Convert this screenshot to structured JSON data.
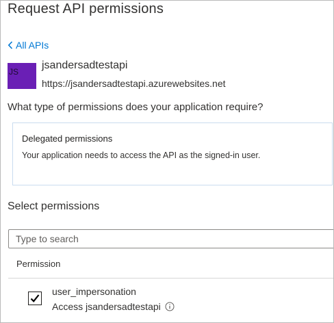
{
  "page": {
    "title": "Request API permissions"
  },
  "nav": {
    "back_label": "All APIs"
  },
  "api": {
    "avatar_initials": "JS",
    "name": "jsandersadtestapi",
    "url": "https://jsandersadtestapi.azurewebsites.net"
  },
  "question": "What type of permissions does your application require?",
  "permission_types": [
    {
      "title": "Delegated permissions",
      "description": "Your application needs to access the API as the signed-in user."
    }
  ],
  "select": {
    "heading": "Select permissions",
    "search_placeholder": "Type to search",
    "column_header": "Permission"
  },
  "permissions": [
    {
      "name": "user_impersonation",
      "description": "Access jsandersadtestapi",
      "checked": true
    }
  ],
  "colors": {
    "accent": "#0078d4",
    "avatar": "#6a1fb5"
  },
  "icons": {
    "back": "chevron-left-icon",
    "check": "checkmark-icon",
    "info": "info-icon"
  }
}
